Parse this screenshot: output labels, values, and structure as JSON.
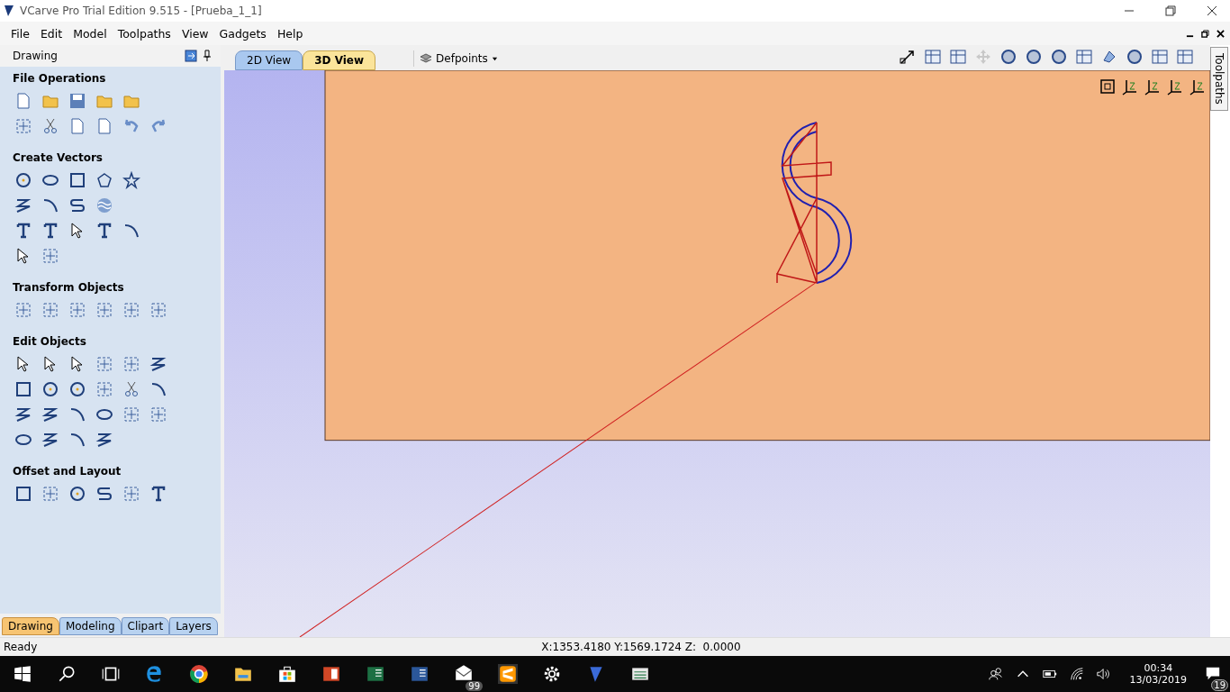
{
  "window": {
    "title": "VCarve Pro Trial Edition 9.515 - [Prueba_1_1]"
  },
  "menu": [
    "File",
    "Edit",
    "Model",
    "Toolpaths",
    "View",
    "Gadgets",
    "Help"
  ],
  "panel": {
    "title": "Drawing",
    "sections": [
      {
        "title": "File Operations"
      },
      {
        "title": "Create Vectors"
      },
      {
        "title": "Transform Objects"
      },
      {
        "title": "Edit Objects"
      },
      {
        "title": "Offset and Layout"
      }
    ],
    "tabs": [
      {
        "label": "Drawing",
        "selected": true
      },
      {
        "label": "Modeling",
        "selected": false
      },
      {
        "label": "Clipart",
        "selected": false
      },
      {
        "label": "Layers",
        "selected": false
      }
    ]
  },
  "view_tabs": [
    {
      "label": "2D View",
      "selected": false
    },
    {
      "label": "3D View",
      "selected": true
    }
  ],
  "layer": {
    "label": "Defpoints"
  },
  "side_tab": {
    "label": "Toolpaths"
  },
  "status_bar": {
    "message": "Ready",
    "coordinates": "X:1353.4180 Y:1569.1724 Z:  0.0000"
  },
  "taskbar": {
    "mail_badge": "99",
    "time": "00:34",
    "date": "13/03/2019",
    "notification_count": "19"
  }
}
